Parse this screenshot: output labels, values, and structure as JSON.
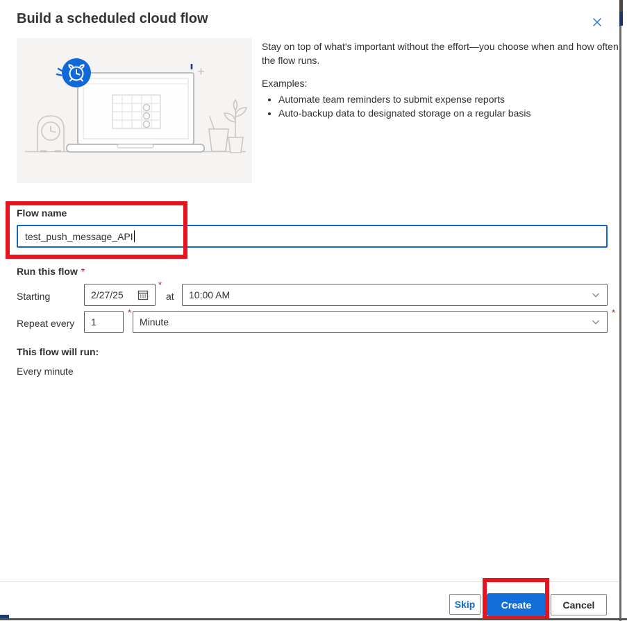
{
  "dialog": {
    "title": "Build a scheduled cloud flow"
  },
  "intro": {
    "description": "Stay on top of what's important without the effort—you choose when and how often the flow runs.",
    "examples_label": "Examples:",
    "examples": [
      "Automate team reminders to submit expense reports",
      "Auto-backup data to designated storage on a regular basis"
    ]
  },
  "flow_name": {
    "label": "Flow name",
    "value": "test_push_message_API"
  },
  "schedule": {
    "section_label": "Run this flow",
    "required_mark": "*",
    "starting_label": "Starting",
    "date_value": "2/27/25",
    "at_label": "at",
    "time_value": "10:00 AM",
    "repeat_label": "Repeat every",
    "interval_value": "1",
    "frequency_value": "Minute"
  },
  "summary": {
    "label": "This flow will run:",
    "value": "Every minute"
  },
  "footer": {
    "skip_label": "Skip",
    "create_label": "Create",
    "cancel_label": "Cancel"
  },
  "icons": {
    "close": "✕",
    "calendar": "▦",
    "chevron_down": "⌄"
  },
  "colors": {
    "accent": "#0078d4",
    "primary_button": "#116ed8",
    "annotation_red": "#e8131d",
    "required_red": "#a4262c",
    "illustration_bg": "#f5f4f2"
  }
}
